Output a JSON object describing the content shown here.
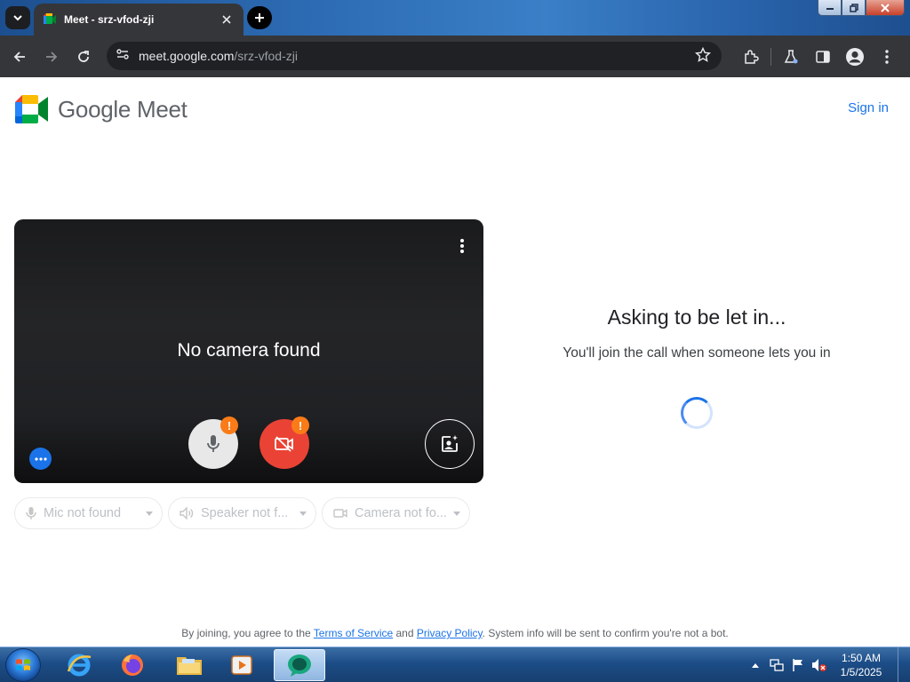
{
  "browser": {
    "tab_title": "Meet - srz-vfod-zji",
    "url_host": "meet.google.com",
    "url_path": "/srz-vfod-zji"
  },
  "header": {
    "logo_text": "Google Meet",
    "sign_in_label": "Sign in"
  },
  "preview": {
    "message": "No camera found",
    "mic_warning": "!",
    "cam_warning": "!"
  },
  "devices": {
    "mic_label": "Mic not found",
    "speaker_label": "Speaker not f...",
    "camera_label": "Camera not fo..."
  },
  "join_status": {
    "title": "Asking to be let in...",
    "subtitle": "You'll join the call when someone lets you in"
  },
  "footer": {
    "prefix": "By joining, you agree to the ",
    "terms": "Terms of Service",
    "and": " and ",
    "privacy": "Privacy Policy",
    "suffix": ". System info will be sent to confirm you're not a bot."
  },
  "taskbar": {
    "time": "1:50 AM",
    "date": "1/5/2025"
  },
  "colors": {
    "accent_blue": "#1a73e8",
    "cam_off_red": "#ea4335",
    "warning_orange": "#fa7b17"
  }
}
